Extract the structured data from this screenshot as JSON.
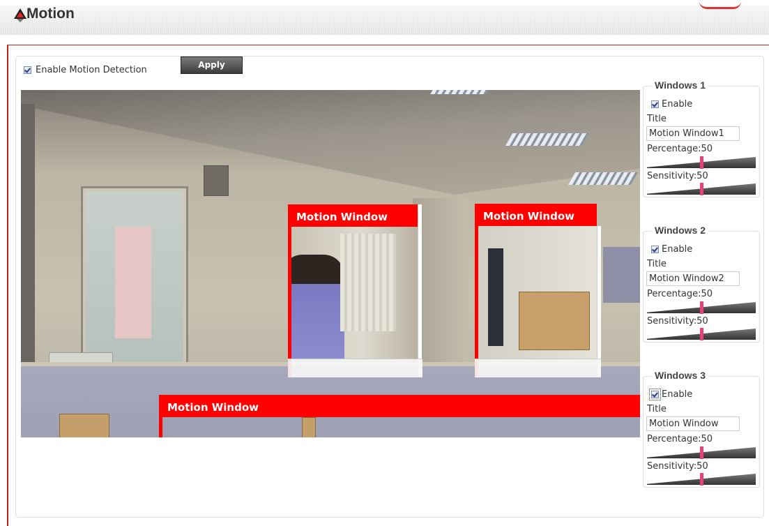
{
  "header": {
    "title": "Motion"
  },
  "controls": {
    "enable_label": "Enable Motion Detection",
    "apply_label": "Apply"
  },
  "video": {
    "motion_windows": [
      {
        "title": "Motion Window"
      },
      {
        "title": "Motion Window"
      },
      {
        "title": "Motion Window"
      }
    ]
  },
  "settings": [
    {
      "legend": "Windows 1",
      "enable_label": "Enable",
      "enabled": true,
      "title_label": "Title",
      "title_value": "Motion Window1",
      "percentage_label": "Percentage:50",
      "percentage": 50,
      "sensitivity_label": "Sensitivity:50",
      "sensitivity": 50
    },
    {
      "legend": "Windows 2",
      "enable_label": "Enable",
      "enabled": true,
      "title_label": "Title",
      "title_value": "Motion Window2",
      "percentage_label": "Percentage:50",
      "percentage": 50,
      "sensitivity_label": "Sensitivity:50",
      "sensitivity": 50
    },
    {
      "legend": "Windows 3",
      "enable_label": "Enable",
      "enabled": true,
      "title_label": "Title",
      "title_value": "Motion Window",
      "percentage_label": "Percentage:50",
      "percentage": 50,
      "sensitivity_label": "Sensitivity:50",
      "sensitivity": 50
    }
  ],
  "colors": {
    "accent": "#ff0000",
    "frame": "#bb2222",
    "slider_knob": "#e8407a"
  }
}
